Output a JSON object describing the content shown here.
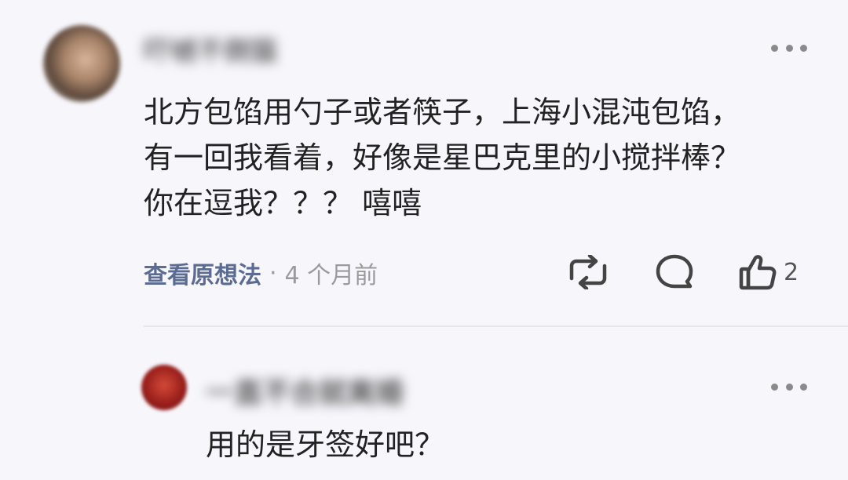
{
  "comment": {
    "author": "吓唬不倒猫",
    "lines": [
      "北方包馅用勺子或者筷子，上海小混沌包馅，",
      "有一回我看着，好像是星巴克里的小搅拌棒？",
      "你在逗我？？？ 嘻嘻"
    ],
    "view_original": "查看原想法",
    "dot": "·",
    "time": "4 个月前",
    "like_count": "2"
  },
  "reply": {
    "author": "一直不合就离婚",
    "text": "用的是牙签好吧？"
  },
  "icons": {
    "more": "more-dots-icon",
    "repost": "repost-icon",
    "comment": "comment-bubble-icon",
    "like": "thumbs-up-icon"
  },
  "colors": {
    "background": "#f7f6fb",
    "text": "#222222",
    "link": "#5b6b91",
    "muted": "#9a9a9a",
    "icon": "#444444"
  }
}
